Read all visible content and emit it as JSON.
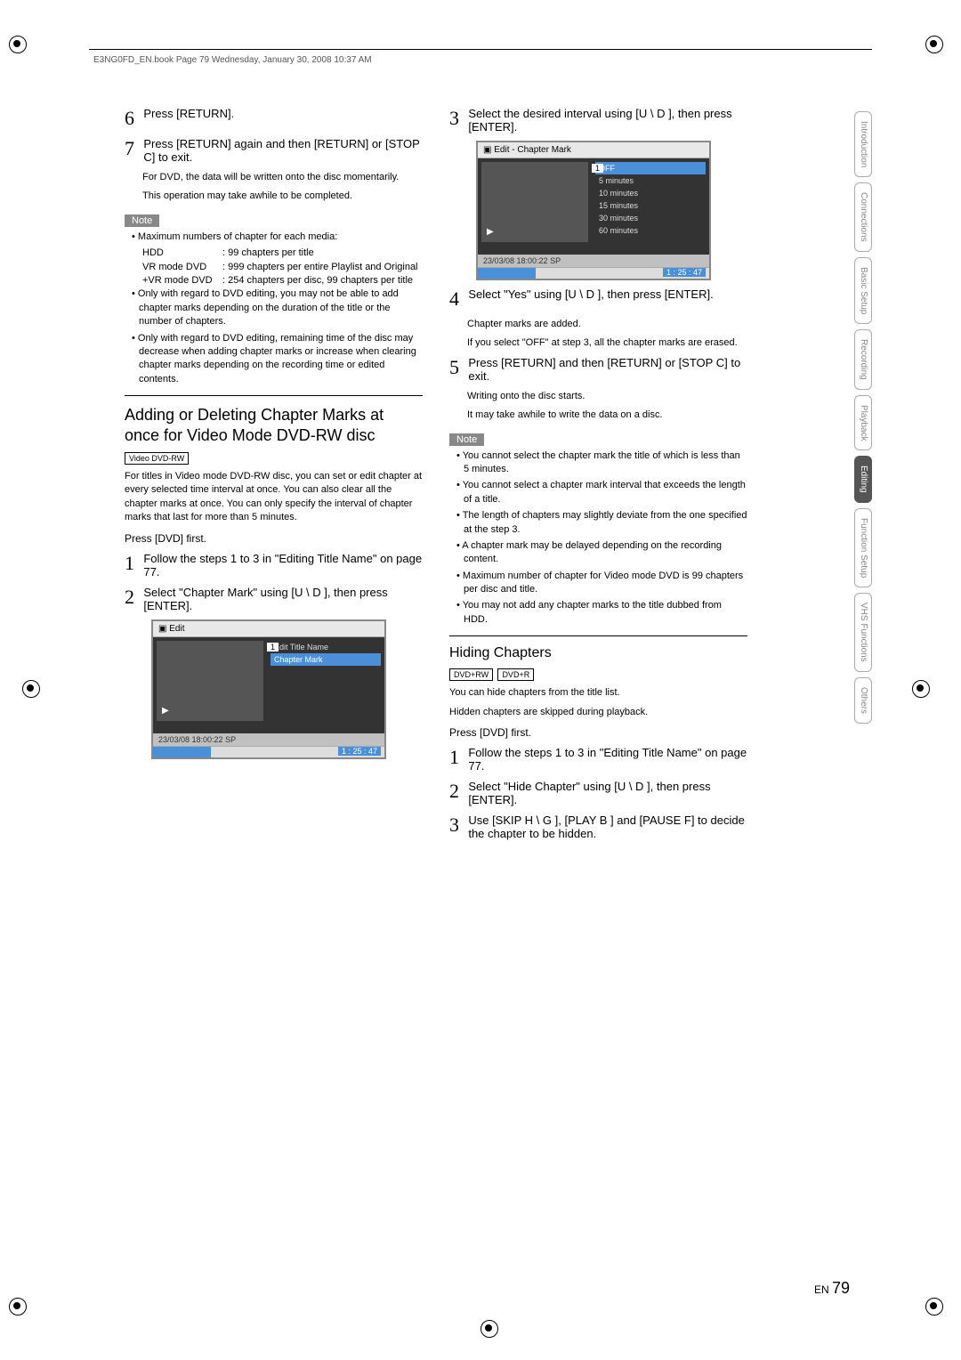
{
  "header": "E3NG0FD_EN.book  Page 79  Wednesday, January 30, 2008  10:37 AM",
  "left": {
    "step6": "Press [RETURN].",
    "step7": "Press [RETURN] again and then [RETURN] or [STOP C] to exit.",
    "step7_sub1": "For DVD, the data will be written onto the disc momentarily.",
    "step7_sub2": "This operation may take awhile to be completed.",
    "note_label": "Note",
    "note1_intro": "• Maximum numbers of chapter for each media:",
    "note1_rows": [
      {
        "l": "HDD",
        "r": ": 99 chapters per title"
      },
      {
        "l": "VR mode DVD",
        "r": ": 999 chapters per entire Playlist and Original"
      },
      {
        "l": "+VR mode DVD",
        "r": ": 254 chapters per disc, 99 chapters per title"
      }
    ],
    "note2": "• Only with regard to DVD editing, you may not be able to add chapter marks depending on the duration of the title or the number of chapters.",
    "note3": "• Only with regard to DVD editing, remaining time of the disc may decrease when adding chapter marks or increase when clearing chapter marks depending on the recording time or edited contents.",
    "section_title": "Adding or Deleting Chapter Marks at once for Video Mode DVD-RW disc",
    "badge1": "Video DVD-RW",
    "intro": "For titles in Video mode DVD-RW disc, you can set or edit chapter at every selected time interval at once. You can also clear all the chapter marks at once. You can only specify the interval of chapter marks that last for more than 5 minutes.",
    "dvd_first": "Press [DVD] first.",
    "step1": "Follow the steps 1 to 3 in \"Editing Title Name\" on page 77.",
    "step2": "Select \"Chapter Mark\" using [U \\ D ], then press [ENTER].",
    "ui1": {
      "title": "Edit",
      "count": "1",
      "menu": [
        "Edit Title Name",
        "Chapter Mark"
      ],
      "selected": 1,
      "status": "23/03/08  18:00:22  SP",
      "time": "1 : 25 : 47"
    }
  },
  "right": {
    "step3": "Select the desired interval using [U \\ D ], then press [ENTER].",
    "ui2": {
      "title": "Edit - Chapter Mark",
      "count": "1",
      "menu": [
        "OFF",
        "5 minutes",
        "10 minutes",
        "15 minutes",
        "30 minutes",
        "60 minutes"
      ],
      "selected": 0,
      "status": "23/03/08  18:00:22  SP",
      "time": "1 : 25 : 47"
    },
    "step4": "Select \"Yes\" using [U \\ D ], then press [ENTER].",
    "step4_sub1": "Chapter marks are added.",
    "step4_sub2": "If you select \"OFF\" at step 3, all the chapter marks are erased.",
    "step5": "Press [RETURN] and then [RETURN] or [STOP C] to exit.",
    "step5_sub1": "Writing onto the disc starts.",
    "step5_sub2": "It may take awhile to write the data on a disc.",
    "note_label": "Note",
    "notes": [
      "• You cannot select the chapter mark the title of which is less than 5 minutes.",
      "• You cannot select a chapter mark interval that exceeds the length of a title.",
      "• The length of chapters may slightly deviate from the one specified at the step 3.",
      "• A chapter mark may be delayed depending on the recording content.",
      "• Maximum number of chapter for Video mode DVD is 99 chapters per disc and title.",
      "• You may not add any chapter marks to the title dubbed from HDD."
    ],
    "hiding_title": "Hiding Chapters",
    "badge_rw": "DVD+RW",
    "badge_r": "DVD+R",
    "hiding_intro1": "You can hide chapters from the title list.",
    "hiding_intro2": "Hidden chapters are skipped during playback.",
    "dvd_first": "Press [DVD] first.",
    "h_step1": "Follow the steps 1 to 3 in \"Editing Title Name\" on page 77.",
    "h_step2": "Select \"Hide Chapter\" using [U \\ D ], then press [ENTER].",
    "h_step3": "Use [SKIP H   \\ G   ], [PLAY B ] and [PAUSE F] to decide the chapter to be hidden."
  },
  "tabs": [
    "Introduction",
    "Connections",
    "Basic Setup",
    "Recording",
    "Playback",
    "Editing",
    "Function Setup",
    "VHS Functions",
    "Others"
  ],
  "active_tab": "Editing",
  "page_label": "EN",
  "page_number": "79"
}
